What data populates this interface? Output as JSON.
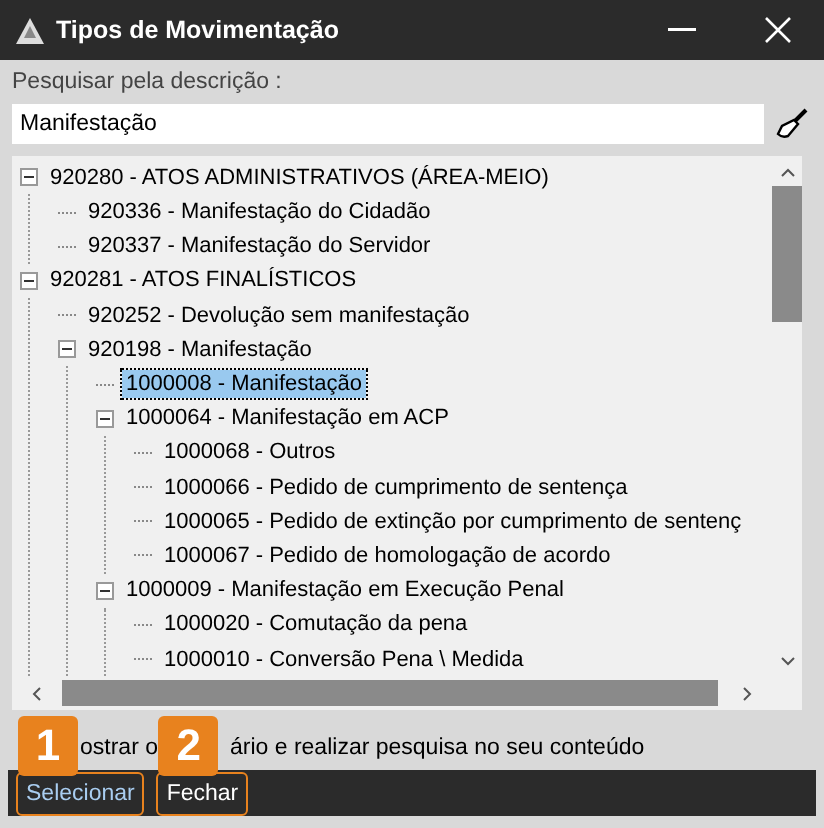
{
  "window": {
    "title": "Tipos de Movimentação"
  },
  "search": {
    "label": "Pesquisar pela descrição :",
    "value": "Manifestação"
  },
  "tree": [
    {
      "label": "920280 - ATOS ADMINISTRATIVOS (ÁREA-MEIO)",
      "expanded": true,
      "selected": false,
      "children": [
        {
          "label": "920336 - Manifestação do Cidadão",
          "selected": false
        },
        {
          "label": "920337 - Manifestação do Servidor",
          "selected": false
        }
      ]
    },
    {
      "label": "920281 - ATOS FINALÍSTICOS",
      "expanded": true,
      "selected": false,
      "children": [
        {
          "label": "920252 - Devolução sem manifestação",
          "selected": false
        },
        {
          "label": "920198 - Manifestação",
          "expanded": true,
          "selected": false,
          "children": [
            {
              "label": "1000008 - Manifestação",
              "selected": true
            },
            {
              "label": "1000064 - Manifestação em ACP",
              "expanded": true,
              "selected": false,
              "children": [
                {
                  "label": "1000068 - Outros",
                  "selected": false
                },
                {
                  "label": "1000066 - Pedido de cumprimento de sentença",
                  "selected": false
                },
                {
                  "label": "1000065 - Pedido de extinção por cumprimento de sentenç",
                  "selected": false
                },
                {
                  "label": "1000067 - Pedido de homologação de acordo",
                  "selected": false
                }
              ]
            },
            {
              "label": "1000009 - Manifestação em Execução Penal",
              "expanded": true,
              "selected": false,
              "children": [
                {
                  "label": "1000020 - Comutação da pena",
                  "selected": false
                },
                {
                  "label": "1000010 - Conversão Pena \\ Medida",
                  "selected": false
                }
              ]
            }
          ]
        }
      ]
    }
  ],
  "option_text": [
    "ostrar o",
    "ário e realizar pesquisa no seu conteúdo"
  ],
  "buttons": [
    {
      "label": "Selecionar",
      "badge": "1"
    },
    {
      "label": "Fechar",
      "badge": "2"
    }
  ]
}
